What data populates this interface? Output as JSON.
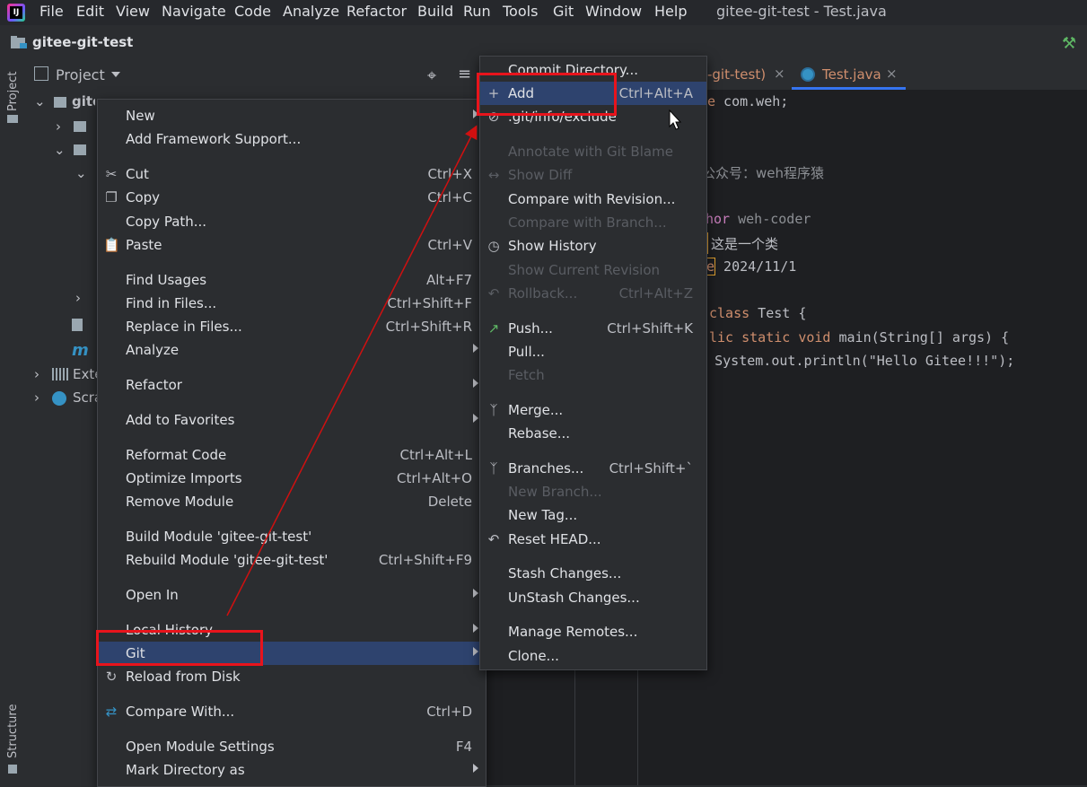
{
  "menubar": {
    "items": [
      "File",
      "Edit",
      "View",
      "Navigate",
      "Code",
      "Analyze",
      "Refactor",
      "Build",
      "Run",
      "Tools",
      "Git",
      "Window",
      "Help"
    ],
    "window_title": "gitee-git-test - Test.java"
  },
  "navbar": {
    "project_name": "gitee-git-test"
  },
  "left_stripe": {
    "project_label": "Project",
    "structure_label": "Structure"
  },
  "project_panel": {
    "header_label": "Project",
    "root_label": "gitee-git-test F:\\git-code\\Test\\gitee-git-test",
    "external_libraries": "Exte",
    "scratches": "Scra"
  },
  "editor": {
    "tabs": [
      {
        "label": "-git-test)"
      },
      {
        "label": "Test.java"
      }
    ],
    "code_lines": [
      {
        "pre": "",
        "kw": "e",
        "rest": " com.weh;"
      },
      {
        "pre": "",
        "kw": "",
        "rest": ""
      },
      {
        "pre": "",
        "kw": "",
        "rest": ""
      },
      {
        "pre": "公众号：weh程序猿",
        "kw": "",
        "rest": ""
      },
      {
        "pre": "",
        "kw": "",
        "rest": ""
      },
      {
        "pre": "",
        "kw": "hor",
        "rest": " weh-coder"
      },
      {
        "pre": "",
        "kw": "",
        "rest": "  这是一个类"
      },
      {
        "pre": "",
        "kw": "e",
        "rest": " 2024/11/1"
      },
      {
        "pre": "",
        "kw": "",
        "rest": ""
      },
      {
        "pre": "",
        "kw": "class",
        "rest": " Test {"
      },
      {
        "pre": "",
        "kw": "lic static void",
        "rest": " main(String[] args) {"
      },
      {
        "pre": "",
        "kw": "",
        "rest": "    System.out.println(\"Hello Gitee!!!\");"
      }
    ]
  },
  "context_menu": {
    "items": [
      {
        "label": "New",
        "shortcut": "",
        "submenu": true
      },
      {
        "label": "Add Framework Support...",
        "shortcut": ""
      },
      {
        "label": "Cut",
        "shortcut": "Ctrl+X",
        "icon": "scissors-icon"
      },
      {
        "label": "Copy",
        "shortcut": "Ctrl+C",
        "icon": "copy-icon"
      },
      {
        "label": "Copy Path...",
        "shortcut": ""
      },
      {
        "label": "Paste",
        "shortcut": "Ctrl+V",
        "icon": "clipboard-icon"
      },
      {
        "label": "Find Usages",
        "shortcut": "Alt+F7"
      },
      {
        "label": "Find in Files...",
        "shortcut": "Ctrl+Shift+F"
      },
      {
        "label": "Replace in Files...",
        "shortcut": "Ctrl+Shift+R"
      },
      {
        "label": "Analyze",
        "shortcut": "",
        "submenu": true
      },
      {
        "label": "Refactor",
        "shortcut": "",
        "submenu": true
      },
      {
        "label": "Add to Favorites",
        "shortcut": "",
        "submenu": true
      },
      {
        "label": "Reformat Code",
        "shortcut": "Ctrl+Alt+L"
      },
      {
        "label": "Optimize Imports",
        "shortcut": "Ctrl+Alt+O"
      },
      {
        "label": "Remove Module",
        "shortcut": "Delete"
      },
      {
        "label": "Build Module 'gitee-git-test'",
        "shortcut": ""
      },
      {
        "label": "Rebuild Module 'gitee-git-test'",
        "shortcut": "Ctrl+Shift+F9"
      },
      {
        "label": "Open In",
        "shortcut": "",
        "submenu": true
      },
      {
        "label": "Local History",
        "shortcut": "",
        "submenu": true
      },
      {
        "label": "Git",
        "shortcut": "",
        "submenu": true
      },
      {
        "label": "Reload from Disk",
        "shortcut": "",
        "icon": "reload-icon"
      },
      {
        "label": "Compare With...",
        "shortcut": "Ctrl+D",
        "icon": "compare-icon"
      },
      {
        "label": "Open Module Settings",
        "shortcut": "F4"
      },
      {
        "label": "Mark Directory as",
        "shortcut": "",
        "submenu": true
      }
    ]
  },
  "git_submenu": {
    "items": [
      {
        "label": "Commit Directory...",
        "shortcut": ""
      },
      {
        "label": "Add",
        "shortcut": "Ctrl+Alt+A",
        "icon": "plus-icon"
      },
      {
        "label": ".git/info/exclude",
        "shortcut": "",
        "icon": "ignore-file-icon"
      },
      {
        "label": "Annotate with Git Blame",
        "shortcut": "",
        "disabled": true
      },
      {
        "label": "Show Diff",
        "shortcut": "",
        "disabled": true,
        "icon": "diff-icon"
      },
      {
        "label": "Compare with Revision...",
        "shortcut": ""
      },
      {
        "label": "Compare with Branch...",
        "shortcut": "",
        "disabled": true
      },
      {
        "label": "Show History",
        "shortcut": "",
        "icon": "clock-icon"
      },
      {
        "label": "Show Current Revision",
        "shortcut": "",
        "disabled": true
      },
      {
        "label": "Rollback...",
        "shortcut": "Ctrl+Alt+Z",
        "disabled": true,
        "icon": "undo-icon"
      },
      {
        "label": "Push...",
        "shortcut": "Ctrl+Shift+K",
        "icon": "push-arrow-icon"
      },
      {
        "label": "Pull...",
        "shortcut": ""
      },
      {
        "label": "Fetch",
        "shortcut": "",
        "disabled": true
      },
      {
        "label": "Merge...",
        "shortcut": "",
        "icon": "merge-icon"
      },
      {
        "label": "Rebase...",
        "shortcut": ""
      },
      {
        "label": "Branches...",
        "shortcut": "Ctrl+Shift+`",
        "icon": "branch-icon"
      },
      {
        "label": "New Branch...",
        "shortcut": "",
        "disabled": true
      },
      {
        "label": "New Tag...",
        "shortcut": ""
      },
      {
        "label": "Reset HEAD...",
        "shortcut": "",
        "icon": "undo-icon"
      },
      {
        "label": "Stash Changes...",
        "shortcut": ""
      },
      {
        "label": "UnStash Changes...",
        "shortcut": ""
      },
      {
        "label": "Manage Remotes...",
        "shortcut": ""
      },
      {
        "label": "Clone...",
        "shortcut": ""
      }
    ]
  },
  "colors": {
    "highlight_box": "#e8141c",
    "arrow": "#d01010",
    "selection": "#2e436e"
  }
}
